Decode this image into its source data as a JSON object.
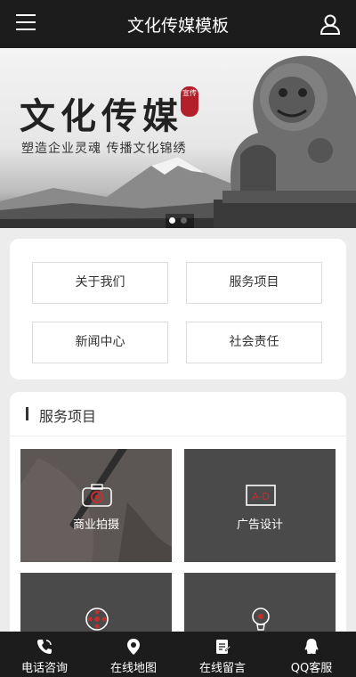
{
  "header": {
    "title": "文化传媒模板",
    "menu_icon": "hamburger-icon",
    "user_icon": "user-icon"
  },
  "banner": {
    "headline": "文化传媒",
    "seal_text": "宣传",
    "slogan": "塑造企业灵魂 传播文化锦绣",
    "slide_count": 2,
    "active_slide": 1
  },
  "nav": [
    {
      "label": "关于我们"
    },
    {
      "label": "服务项目"
    },
    {
      "label": "新闻中心"
    },
    {
      "label": "社会责任"
    }
  ],
  "services": {
    "title": "服务项目",
    "items": [
      {
        "label": "商业拍摄",
        "icon": "camera-icon"
      },
      {
        "label": "广告设计",
        "icon": "ad-icon"
      },
      {
        "label": "",
        "icon": "film-reel-icon"
      },
      {
        "label": "",
        "icon": "lightbulb-icon"
      }
    ]
  },
  "footer": [
    {
      "label": "电话咨询",
      "icon": "phone-icon"
    },
    {
      "label": "在线地图",
      "icon": "map-pin-icon"
    },
    {
      "label": "在线留言",
      "icon": "message-icon"
    },
    {
      "label": "QQ客服",
      "icon": "qq-icon"
    }
  ],
  "colors": {
    "dark": "#1c1c1c",
    "seal": "#b3202a",
    "tile": "#4a4a4a"
  }
}
